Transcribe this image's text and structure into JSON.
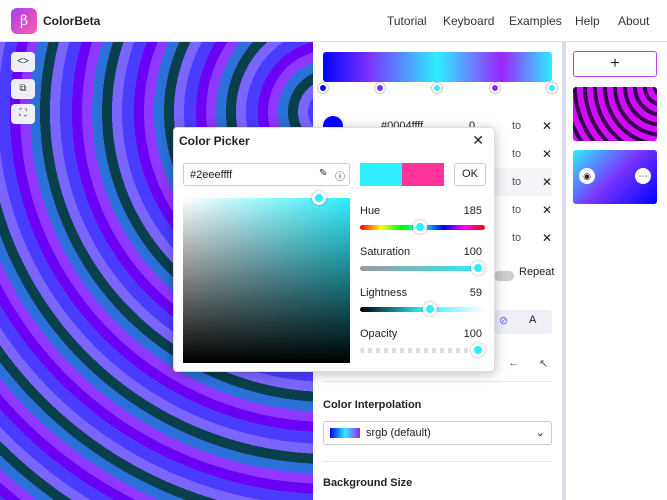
{
  "app": {
    "logo_glyph": "β",
    "name": "ColorBeta"
  },
  "nav": [
    "Tutorial",
    "Keyboard",
    "Examples",
    "Help",
    "About"
  ],
  "tools": [
    {
      "icon": "code-icon",
      "glyph": "<>"
    },
    {
      "icon": "layers-icon",
      "glyph": "⧉"
    },
    {
      "icon": "fullscreen-icon",
      "glyph": "⛶"
    }
  ],
  "stops": [
    {
      "hex": "#0004ffff",
      "position": "0",
      "to": "to",
      "color": "#0004ff"
    },
    {
      "to": "to",
      "color": "#7a33ff"
    },
    {
      "to": "to",
      "color": "#2eeeff"
    },
    {
      "to": "to",
      "color": "#9b25ff"
    },
    {
      "to": "to",
      "color": "#2eeeff"
    }
  ],
  "picker": {
    "title": "Color Picker",
    "close": "✕",
    "hex": "#2eeeffff",
    "ok": "OK",
    "old_color": "#2eeeff",
    "new_color": "#ff3399",
    "sliders": [
      {
        "label": "Hue",
        "value": "185",
        "fraction": 0.51
      },
      {
        "label": "Saturation",
        "value": "100",
        "fraction": 1.0
      },
      {
        "label": "Lightness",
        "value": "59",
        "fraction": 0.59
      },
      {
        "label": "Opacity",
        "value": "100",
        "fraction": 1.0
      }
    ]
  },
  "repeat_label": "Repeat",
  "sections": {
    "interpolation": "Color Interpolation",
    "interpolation_value": "srgb (default)",
    "background_size": "Background Size"
  },
  "sidebar": {
    "add": "+"
  },
  "colors": {
    "accent": "#b844f3",
    "primary_color": "#2eeeff"
  }
}
